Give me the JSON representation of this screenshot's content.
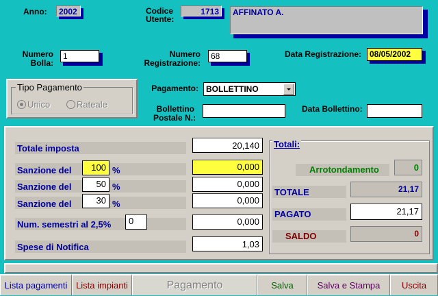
{
  "header": {
    "anno_label": "Anno:",
    "anno_value": "2002",
    "codice_label_1": "Codice",
    "codice_label_2": "Utente:",
    "codice_value": "1713",
    "utente_name": "AFFINATO A."
  },
  "bolla": {
    "numero_bolla_label_1": "Numero",
    "numero_bolla_label_2": "Bolla:",
    "numero_bolla_value": "1",
    "numero_reg_label_1": "Numero",
    "numero_reg_label_2": "Registrazione:",
    "numero_reg_value": "68",
    "data_reg_label": "Data Registrazione:",
    "data_reg_value": "08/05/2002"
  },
  "tipo_pagamento": {
    "title": "Tipo Pagamento",
    "option_unico": "Unico",
    "option_rateale": "Rateale"
  },
  "pagamento": {
    "label": "Pagamento:",
    "value": "BOLLETTINO",
    "bollettino_label_1": "Bollettino",
    "bollettino_label_2": "Postale N.:",
    "bollettino_value": "",
    "data_bollettino_label": "Data Bollettino:",
    "data_bollettino_value": ""
  },
  "importi": {
    "totale_imposta_label": "Totale imposta",
    "totale_imposta_value": "20,140",
    "sanzione_label": "Sanzione del",
    "percent_sign": "%",
    "sanzione_1_pct": "100",
    "sanzione_1_value": "0,000",
    "sanzione_2_pct": "50",
    "sanzione_2_value": "0,000",
    "sanzione_3_pct": "30",
    "sanzione_3_value": "0,000",
    "semestri_label": "Num. semestri al 2,5%",
    "semestri_count": "0",
    "semestri_value": "0,000",
    "spese_label": "Spese di Notifica",
    "spese_value": "1,03"
  },
  "totali": {
    "title": "Totali:",
    "arrotondamento_label": "Arrotondamento",
    "arrotondamento_value": "0",
    "totale_label": "TOTALE",
    "totale_value": "21,17",
    "pagato_label": "PAGATO",
    "pagato_value": "21,17",
    "saldo_label": "SALDO",
    "saldo_value": "0"
  },
  "tabs": {
    "lista_pagamenti": "Lista pagamenti",
    "lista_impianti": "Lista impianti",
    "pagamento": "Pagamento",
    "salva": "Salva",
    "salva_stampa": "Salva e Stampa",
    "uscita": "Uscita"
  },
  "colors": {
    "background": "#15c0c0",
    "panel": "#d4d0c8",
    "label_blue": "#0000a0",
    "highlight_yellow": "#ffff40",
    "arrotondamento_green": "#008000",
    "saldo_red": "#800000"
  }
}
